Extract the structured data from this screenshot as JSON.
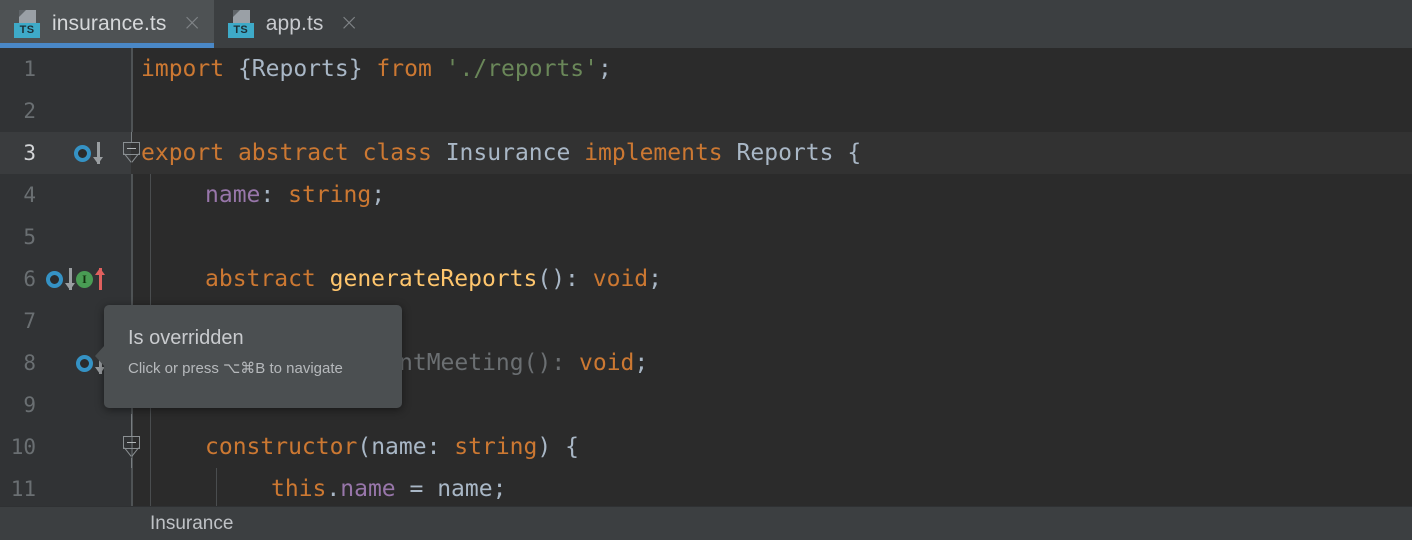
{
  "tabs": [
    {
      "label": "insurance.ts",
      "icon": "typescript-file-icon",
      "badge": "TS",
      "close": "×",
      "active": true
    },
    {
      "label": "app.ts",
      "icon": "typescript-file-icon",
      "badge": "TS",
      "close": "×",
      "active": false
    }
  ],
  "editor": {
    "lines": [
      {
        "no": "1",
        "current": false
      },
      {
        "no": "2",
        "current": false
      },
      {
        "no": "3",
        "current": true
      },
      {
        "no": "4",
        "current": false
      },
      {
        "no": "5",
        "current": false
      },
      {
        "no": "6",
        "current": false
      },
      {
        "no": "7",
        "current": false
      },
      {
        "no": "8",
        "current": false
      },
      {
        "no": "9",
        "current": false
      },
      {
        "no": "10",
        "current": false
      },
      {
        "no": "11",
        "current": false
      }
    ],
    "code": {
      "l1": {
        "kw1": "import",
        "ids": " {Reports} ",
        "kw2": "from",
        "sp": " ",
        "str": "'./reports'",
        "semi": ";"
      },
      "l3": {
        "kw1": "export",
        "sp1": " ",
        "kw2": "abstract",
        "sp2": " ",
        "kw3": "class",
        "sp3": " ",
        "name": "Insurance",
        "sp4": " ",
        "kw4": "implements",
        "sp5": " ",
        "iface": "Reports",
        "brace": " {"
      },
      "l4": {
        "field": "name",
        "colon": ": ",
        "type": "string",
        "semi": ";"
      },
      "l6": {
        "kw": "abstract",
        "sp": " ",
        "fn": "generateReports",
        "parens": "(): ",
        "type": "void",
        "semi": ";"
      },
      "l8": {
        "text": "ntMeeting(): ",
        "type": "void",
        "semi": ";"
      },
      "l10": {
        "fn": "constructor",
        "paren1": "(",
        "param": "name",
        "colon": ": ",
        "type": "string",
        "paren2": ") {"
      },
      "l11": {
        "kw": "this",
        "dot": ".",
        "field": "name",
        "eq": " = ",
        "id": "name",
        "semi": ";"
      }
    },
    "gutter_markers": {
      "line3": {
        "implemented": "implemented-marker",
        "arrow": "down-arrow"
      },
      "line6": {
        "implemented": "implemented-marker",
        "arrow": "down-arrow",
        "overridden_glyph": "I",
        "up_arrow": "up-arrow"
      },
      "line8": {
        "implemented": "implemented-marker",
        "arrow": "down-arrow"
      }
    }
  },
  "tooltip": {
    "title": "Is overridden",
    "subtitle": "Click or press ⌥⌘B to navigate"
  },
  "breadcrumb": {
    "items": [
      "Insurance"
    ]
  },
  "colors": {
    "tabbar_bg": "#3c3f41",
    "active_tab_bg": "#4e5254",
    "active_tab_underline": "#4a88c7",
    "editor_bg": "#2b2b2b",
    "gutter_bg": "#313335",
    "current_line_bg": "#323232",
    "keyword": "#cc7832",
    "identifier": "#a9b7c6",
    "function": "#ffc66d",
    "field": "#9876aa",
    "string": "#6a8759",
    "ts_badge": "#3eaac8",
    "implemented_marker": "#3592c4",
    "overridden_marker": "#499c54",
    "up_arrow": "#e0605e",
    "tooltip_bg": "#4b4f51"
  }
}
